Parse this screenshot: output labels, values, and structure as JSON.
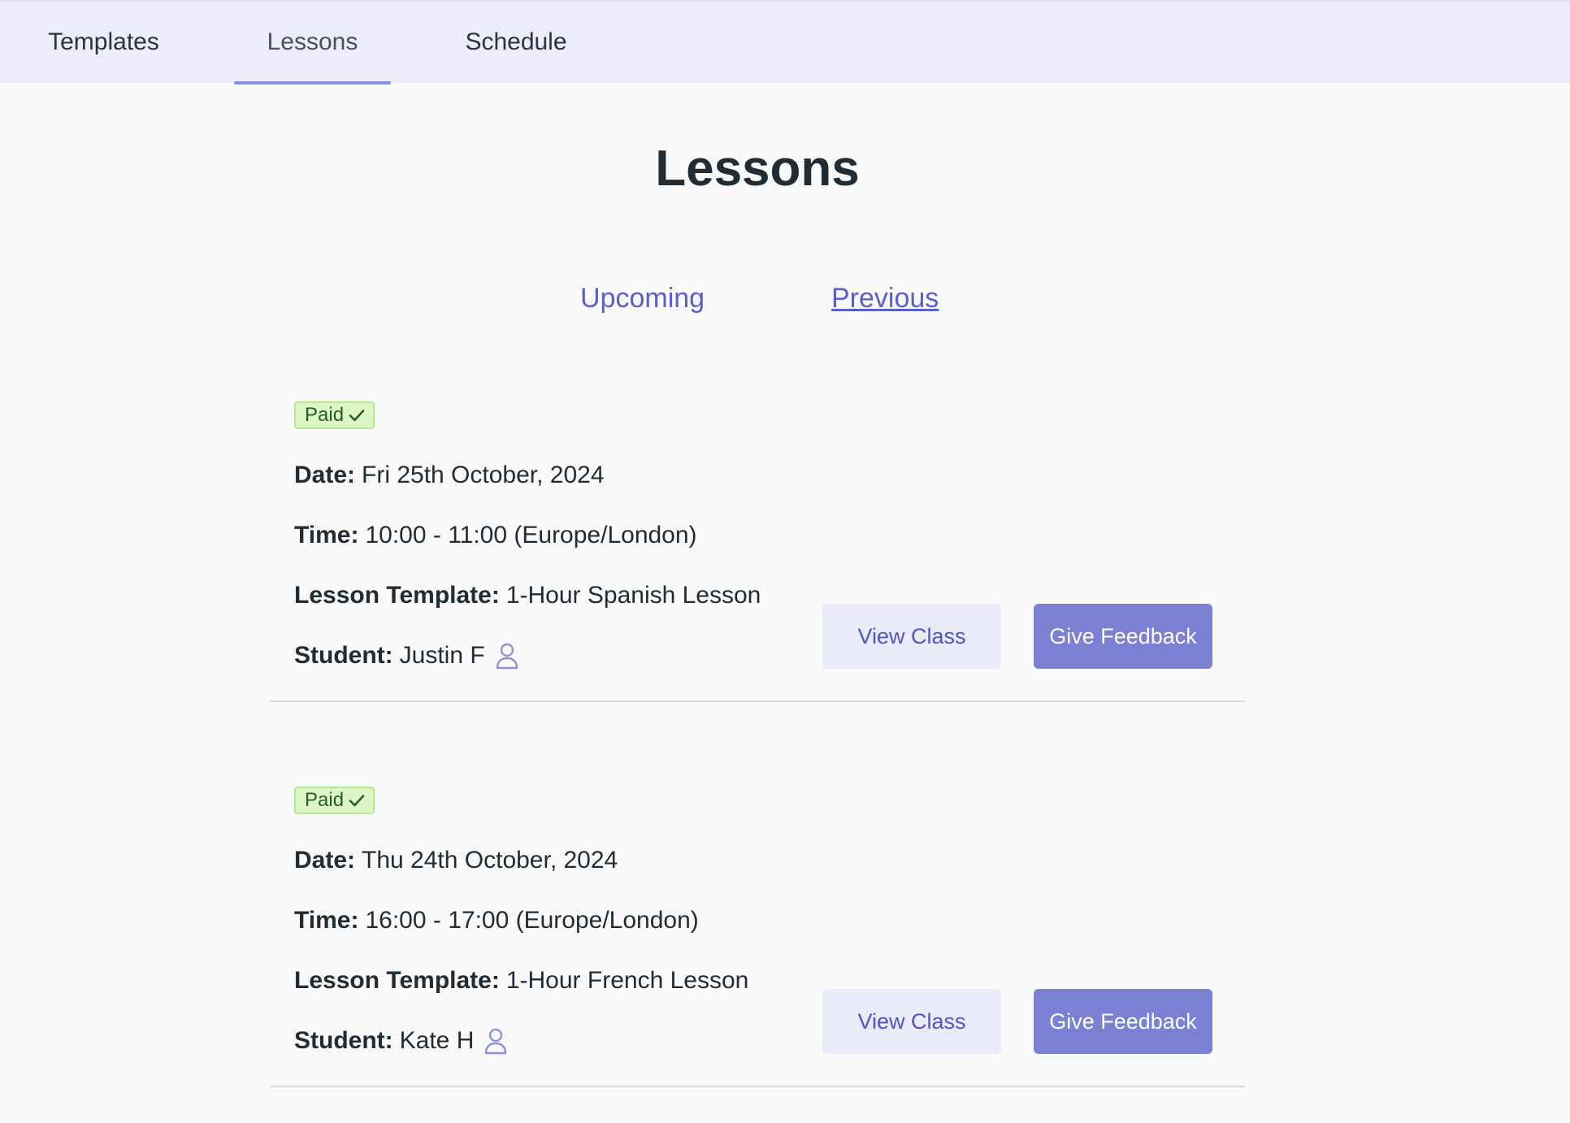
{
  "nav": {
    "tabs": [
      {
        "label": "Templates"
      },
      {
        "label": "Lessons"
      },
      {
        "label": "Schedule"
      }
    ],
    "active_tab": "Lessons"
  },
  "page": {
    "title": "Lessons",
    "filters": {
      "upcoming": "Upcoming",
      "previous": "Previous"
    },
    "selected_filter": "Previous"
  },
  "lessons": [
    {
      "status": "Paid",
      "date_label": "Date:",
      "date": "Fri 25th October, 2024",
      "time_label": "Time:",
      "time": "10:00 - 11:00 (Europe/London)",
      "template_label": "Lesson Template:",
      "template": "1-Hour Spanish Lesson",
      "student_label": "Student:",
      "student": "Justin F",
      "view_label": "View Class",
      "feedback_label": "Give Feedback"
    },
    {
      "status": "Paid",
      "date_label": "Date:",
      "date": "Thu 24th October, 2024",
      "time_label": "Time:",
      "time": "16:00 - 17:00 (Europe/London)",
      "template_label": "Lesson Template:",
      "template": "1-Hour French Lesson",
      "student_label": "Student:",
      "student": "Kate H",
      "view_label": "View Class",
      "feedback_label": "Give Feedback"
    }
  ],
  "colors": {
    "accent": "#7b80d3",
    "link": "#5a5fc9",
    "nav_bg": "#ecedf9",
    "paid_badge_bg": "#dcf7c5",
    "paid_badge_border": "#b4eb90"
  },
  "icons": {
    "status": "checkmark-icon",
    "student": "user-icon"
  }
}
